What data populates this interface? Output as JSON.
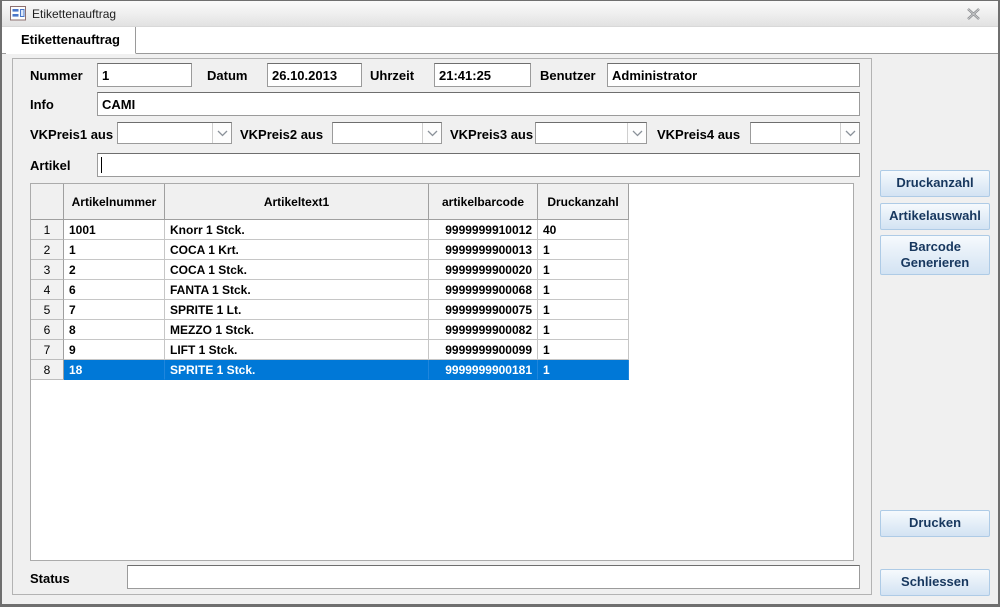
{
  "window": {
    "title": "Etikettenauftrag"
  },
  "tab": {
    "label": "Etikettenauftrag"
  },
  "form": {
    "nummer": {
      "label": "Nummer",
      "value": "1"
    },
    "datum": {
      "label": "Datum",
      "value": "26.10.2013"
    },
    "uhrzeit": {
      "label": "Uhrzeit",
      "value": "21:41:25"
    },
    "benutzer": {
      "label": "Benutzer",
      "value": "Administrator"
    },
    "info": {
      "label": "Info",
      "value": "CAMI"
    },
    "vkpreis1": {
      "label": "VKPreis1 aus",
      "value": ""
    },
    "vkpreis2": {
      "label": "VKPreis2 aus",
      "value": ""
    },
    "vkpreis3": {
      "label": "VKPreis3 aus",
      "value": ""
    },
    "vkpreis4": {
      "label": "VKPreis4 aus",
      "value": ""
    },
    "artikel": {
      "label": "Artikel",
      "value": ""
    }
  },
  "table": {
    "columns": [
      "Artikelnummer",
      "Artikeltext1",
      "artikelbarcode",
      "Druckanzahl"
    ],
    "rows": [
      {
        "num": "1",
        "artikelnummer": "1001",
        "artikeltext1": "Knorr 1 Stck.",
        "artikelbarcode": "9999999910012",
        "druckanzahl": "40",
        "selected": false
      },
      {
        "num": "2",
        "artikelnummer": "1",
        "artikeltext1": "COCA 1 Krt.",
        "artikelbarcode": "9999999900013",
        "druckanzahl": "1",
        "selected": false
      },
      {
        "num": "3",
        "artikelnummer": "2",
        "artikeltext1": "COCA 1 Stck.",
        "artikelbarcode": "9999999900020",
        "druckanzahl": "1",
        "selected": false
      },
      {
        "num": "4",
        "artikelnummer": "6",
        "artikeltext1": "FANTA 1 Stck.",
        "artikelbarcode": "9999999900068",
        "druckanzahl": "1",
        "selected": false
      },
      {
        "num": "5",
        "artikelnummer": "7",
        "artikeltext1": "SPRITE 1 Lt.",
        "artikelbarcode": "9999999900075",
        "druckanzahl": "1",
        "selected": false
      },
      {
        "num": "6",
        "artikelnummer": "8",
        "artikeltext1": "MEZZO 1 Stck.",
        "artikelbarcode": "9999999900082",
        "druckanzahl": "1",
        "selected": false
      },
      {
        "num": "7",
        "artikelnummer": "9",
        "artikeltext1": "LIFT 1 Stck.",
        "artikelbarcode": "9999999900099",
        "druckanzahl": "1",
        "selected": false
      },
      {
        "num": "8",
        "artikelnummer": "18",
        "artikeltext1": "SPRITE 1 Stck.",
        "artikelbarcode": "9999999900181",
        "druckanzahl": "1",
        "selected": true
      }
    ]
  },
  "buttons": {
    "druckanzahl": "Druckanzahl",
    "artikelauswahl": "Artikelauswahl",
    "barcode_generieren": "Barcode Generieren",
    "drucken": "Drucken",
    "schliessen": "Schliessen"
  },
  "status": {
    "label": "Status",
    "value": ""
  },
  "colors": {
    "selection": "#0078d7",
    "button_text": "#17375e",
    "button_border": "#aecbe6",
    "window_background": "#f0f0f0"
  }
}
